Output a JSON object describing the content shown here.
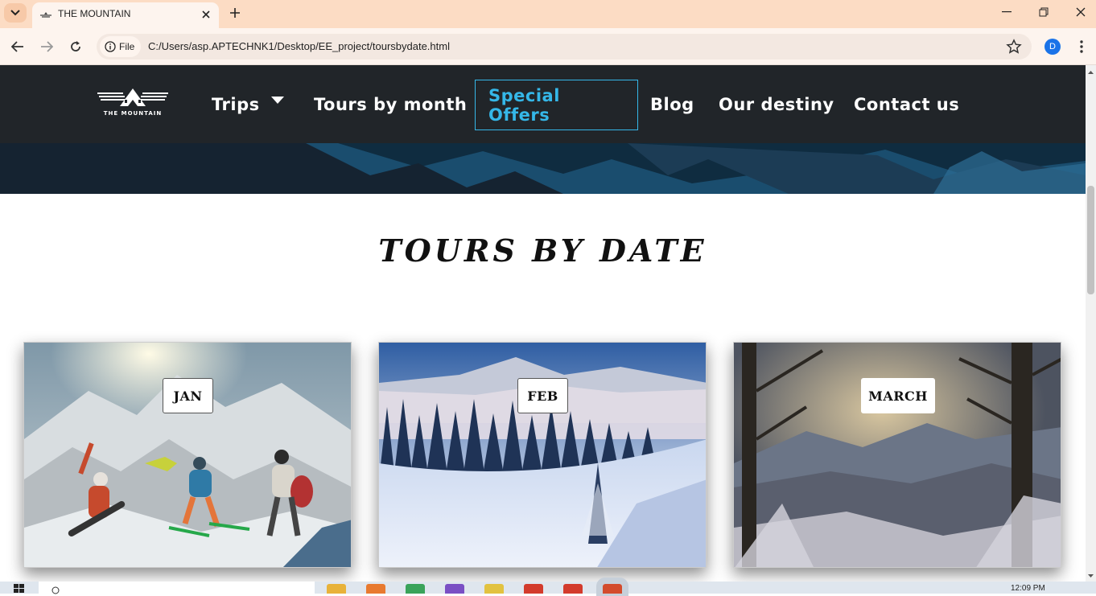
{
  "browser": {
    "tab_title": "THE MOUNTAIN",
    "site_chip_label": "File",
    "url": "C:/Users/asp.APTECHNK1/Desktop/EE_project/toursbydate.html",
    "profile_initial": "D"
  },
  "site": {
    "nav": {
      "items": [
        {
          "label": "Trips",
          "has_dropdown": true
        },
        {
          "label": "Tours by month"
        },
        {
          "label": "Special Offers",
          "active": true
        },
        {
          "label": "Blog"
        },
        {
          "label": "Our destiny"
        },
        {
          "label": "Contact us"
        }
      ]
    },
    "heading": "TOURS BY DATE",
    "cards": [
      {
        "month": "JAN",
        "scene": "skiers and snowboarders on a snowy mountain"
      },
      {
        "month": "FEB",
        "scene": "snow-covered pine forest with mountain"
      },
      {
        "month": "MARCH",
        "scene": "snowy forest at dusk"
      }
    ]
  },
  "taskbar": {
    "time": "12:09 PM"
  },
  "colors": {
    "tabbar_bg": "#fcdcc4",
    "navbar_bg": "#212529",
    "nav_active": "#35b7e8"
  }
}
